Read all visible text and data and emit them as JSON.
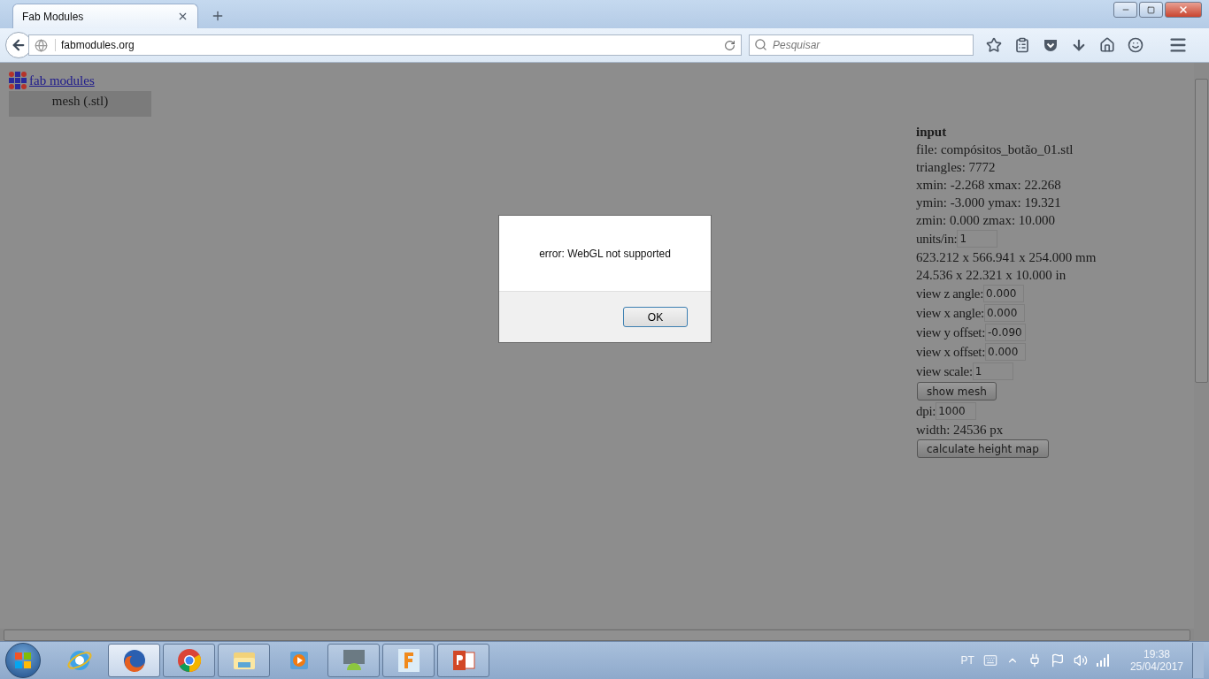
{
  "browser": {
    "tab": {
      "title": "Fab Modules"
    },
    "address": "fabmodules.org",
    "search": {
      "placeholder": "Pesquisar"
    }
  },
  "page": {
    "logo_link": "fab modules",
    "module": "mesh (.stl)",
    "panel": [
      {
        "kind": "heading",
        "text": "input"
      },
      {
        "kind": "text",
        "text": "file: compósitos_botão_01.stl"
      },
      {
        "kind": "text",
        "text": "triangles: 7772"
      },
      {
        "kind": "text",
        "text": "xmin: -2.268 xmax: 22.268"
      },
      {
        "kind": "text",
        "text": "ymin: -3.000 ymax: 19.321"
      },
      {
        "kind": "text",
        "text": "zmin: 0.000 zmax: 10.000"
      },
      {
        "kind": "field",
        "label": "units/in:",
        "value": "1"
      },
      {
        "kind": "text",
        "text": "623.212 x 566.941 x 254.000 mm"
      },
      {
        "kind": "text",
        "text": "24.536 x 22.321 x 10.000 in"
      },
      {
        "kind": "field",
        "label": "view z angle:",
        "value": "0.000"
      },
      {
        "kind": "field",
        "label": "view x angle:",
        "value": "0.000"
      },
      {
        "kind": "field",
        "label": "view y offset:",
        "value": "-0.090"
      },
      {
        "kind": "field",
        "label": "view x offset:",
        "value": "0.000"
      },
      {
        "kind": "field",
        "label": "view scale:",
        "value": "1"
      },
      {
        "kind": "button",
        "text": "show mesh"
      },
      {
        "kind": "field",
        "label": "dpi:",
        "value": "1000"
      },
      {
        "kind": "text",
        "text": "width: 24536 px"
      },
      {
        "kind": "button",
        "text": "calculate height map"
      }
    ]
  },
  "dialog": {
    "message": "error: WebGL not supported",
    "button": "OK"
  },
  "taskbar": {
    "apps": [
      {
        "kind": "ie",
        "open": false,
        "selected": false
      },
      {
        "kind": "firefox",
        "open": true,
        "selected": true
      },
      {
        "kind": "chrome",
        "open": true,
        "selected": false
      },
      {
        "kind": "explorer",
        "open": true,
        "selected": false
      },
      {
        "kind": "media",
        "open": false,
        "selected": false
      },
      {
        "kind": "android",
        "open": true,
        "selected": false
      },
      {
        "kind": "fusion",
        "open": true,
        "selected": false
      },
      {
        "kind": "powerpoint",
        "open": true,
        "selected": false
      }
    ]
  },
  "tray": {
    "language": "PT",
    "time": "19:38",
    "date": "25/04/2017"
  }
}
